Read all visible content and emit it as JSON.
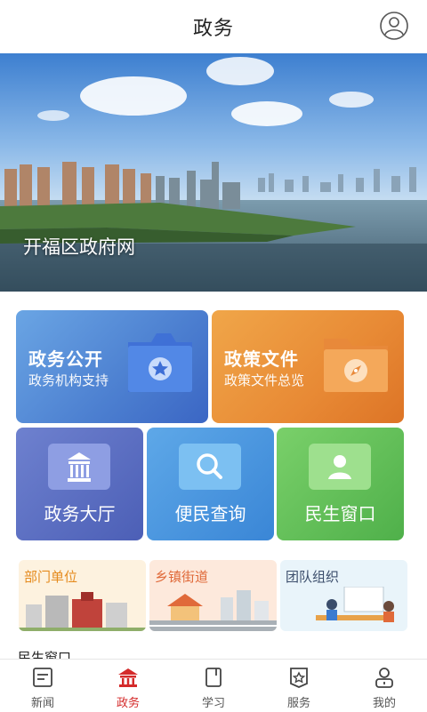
{
  "header": {
    "title": "政务",
    "user_icon": "user-circle-icon"
  },
  "banner": {
    "caption": "开福区政府网"
  },
  "cards": {
    "zwgk": {
      "title": "政务公开",
      "subtitle": "政务机构支持",
      "icon": "folder-star-icon"
    },
    "zcwj": {
      "title": "政策文件",
      "subtitle": "政策文件总览",
      "icon": "folder-compass-icon"
    },
    "zwdt": {
      "label": "政务大厅",
      "icon": "government-building-icon"
    },
    "bmcx": {
      "label": "便民查询",
      "icon": "search-icon"
    },
    "msck": {
      "label": "民生窗口",
      "icon": "person-icon"
    }
  },
  "sections": [
    {
      "label": "部门单位"
    },
    {
      "label": "乡镇街道"
    },
    {
      "label": "团队组织"
    }
  ],
  "section_peek": "民生窗口",
  "tabbar": {
    "items": [
      {
        "label": "新闻",
        "icon": "news-icon",
        "active": false
      },
      {
        "label": "政务",
        "icon": "government-icon",
        "active": true
      },
      {
        "label": "学习",
        "icon": "book-icon",
        "active": false
      },
      {
        "label": "服务",
        "icon": "service-icon",
        "active": false
      },
      {
        "label": "我的",
        "icon": "profile-icon",
        "active": false
      }
    ]
  },
  "colors": {
    "accent": "#d42a2a",
    "text": "#222222"
  }
}
